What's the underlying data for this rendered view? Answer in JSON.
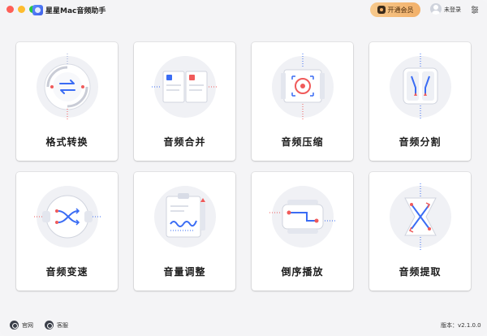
{
  "app": {
    "title": "星星Mac音频助手"
  },
  "header": {
    "vip_label": "开通会员",
    "login_label": "未登录"
  },
  "cards": [
    {
      "label": "格式转换",
      "icon": "format-convert-icon"
    },
    {
      "label": "音频合并",
      "icon": "audio-merge-icon"
    },
    {
      "label": "音频压缩",
      "icon": "audio-compress-icon"
    },
    {
      "label": "音频分割",
      "icon": "audio-split-icon"
    },
    {
      "label": "音频变速",
      "icon": "audio-speed-icon"
    },
    {
      "label": "音量调整",
      "icon": "volume-adjust-icon"
    },
    {
      "label": "倒序播放",
      "icon": "reverse-play-icon"
    },
    {
      "label": "音频提取",
      "icon": "audio-extract-icon"
    }
  ],
  "footer": {
    "website_label": "官网",
    "support_label": "客服",
    "version_label": "版本：v2.1.0.0"
  },
  "colors": {
    "accent": "#3a6cf4",
    "danger": "#f05a5a",
    "vip_gradient_start": "#f7c98c",
    "vip_gradient_end": "#f2b06a"
  }
}
